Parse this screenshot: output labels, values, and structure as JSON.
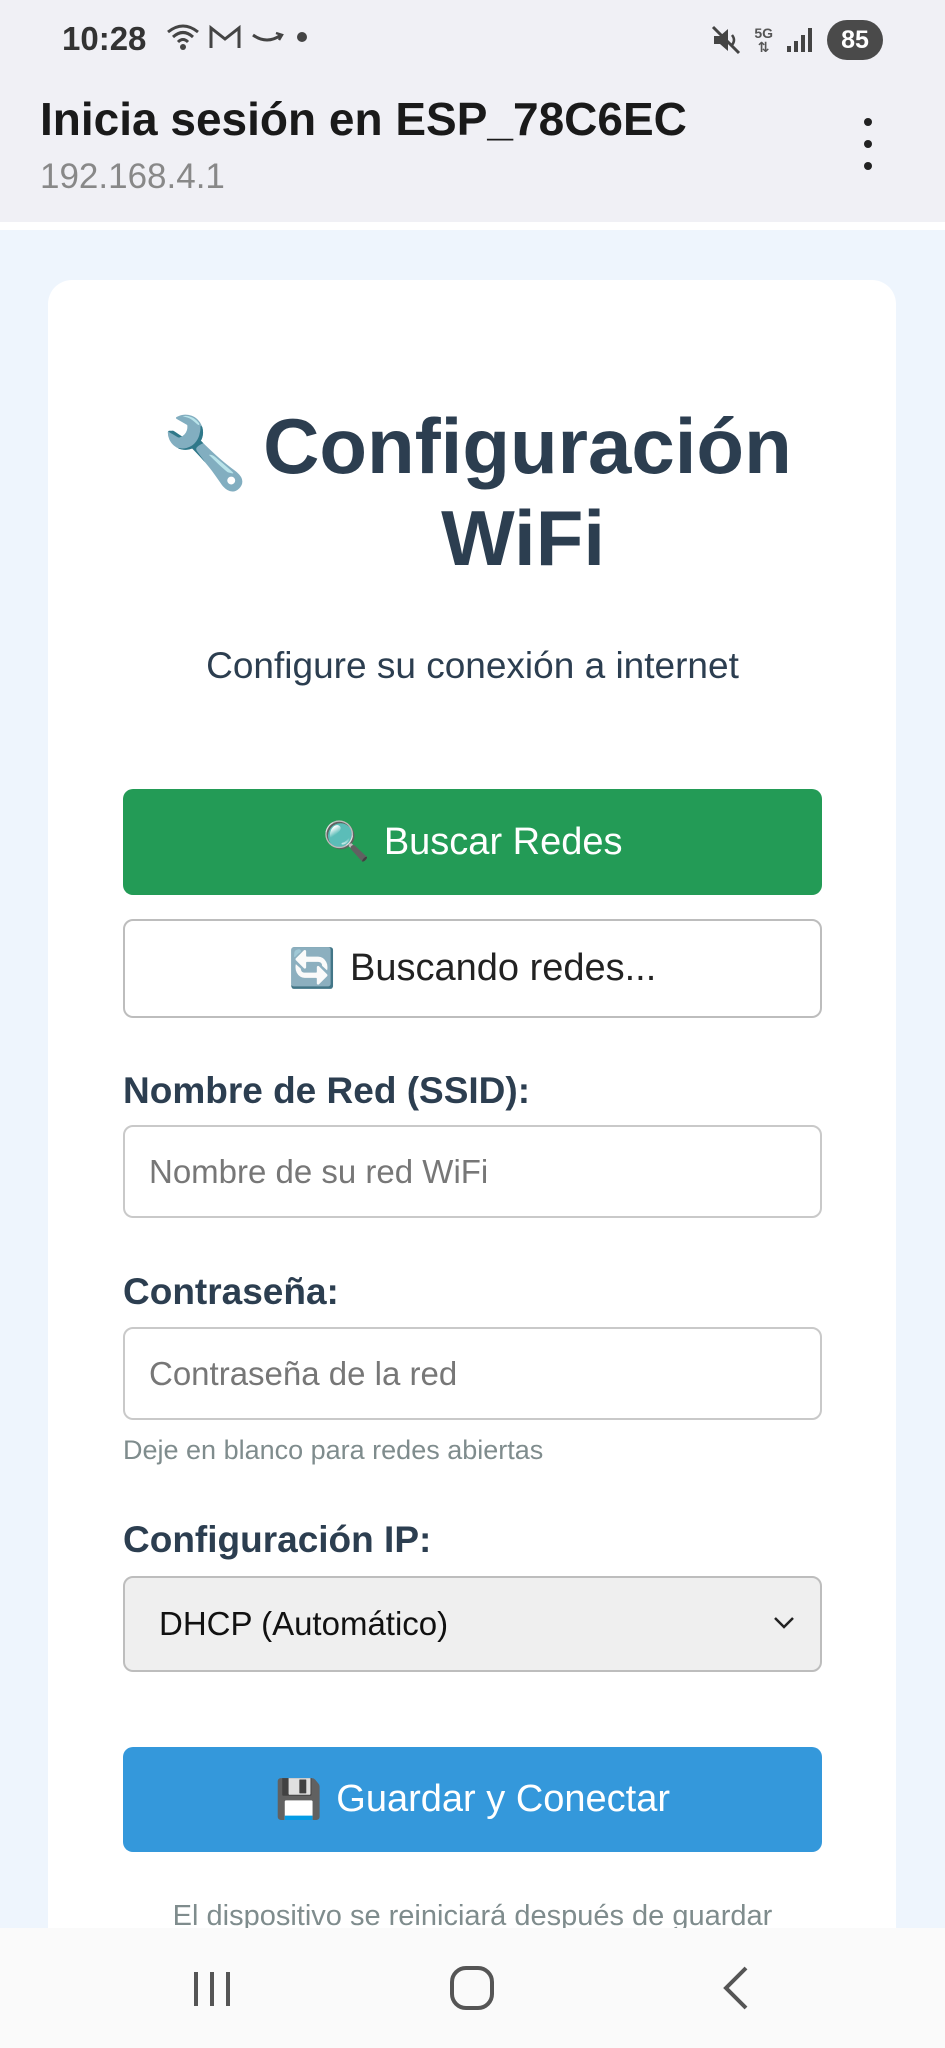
{
  "status_bar": {
    "time": "10:28",
    "network": "5G",
    "battery": "85"
  },
  "header": {
    "title": "Inicia sesión en ESP_78C6EC",
    "url": "192.168.4.1"
  },
  "card": {
    "heading_icon": "🔧",
    "heading": "Configuración WiFi",
    "subtitle": "Configure su conexión a internet",
    "scan_button": {
      "icon": "🔍",
      "label": "Buscar Redes",
      "color": "#239b56"
    },
    "scanning_button": {
      "icon": "🔄",
      "label": "Buscando redes..."
    },
    "ssid": {
      "label": "Nombre de Red (SSID):",
      "placeholder": "Nombre de su red WiFi",
      "value": ""
    },
    "password": {
      "label": "Contraseña:",
      "placeholder": "Contraseña de la red",
      "value": "",
      "hint": "Deje en blanco para redes abiertas"
    },
    "ip_config": {
      "label": "Configuración IP:",
      "selected": "DHCP (Automático)"
    },
    "save_button": {
      "icon": "💾",
      "label": "Guardar y Conectar",
      "color": "#3498db"
    },
    "footnote": "El dispositivo se reiniciará después de guardar"
  },
  "nav": {
    "recent": "recent-apps-icon",
    "home": "home-icon",
    "back": "back-icon"
  }
}
